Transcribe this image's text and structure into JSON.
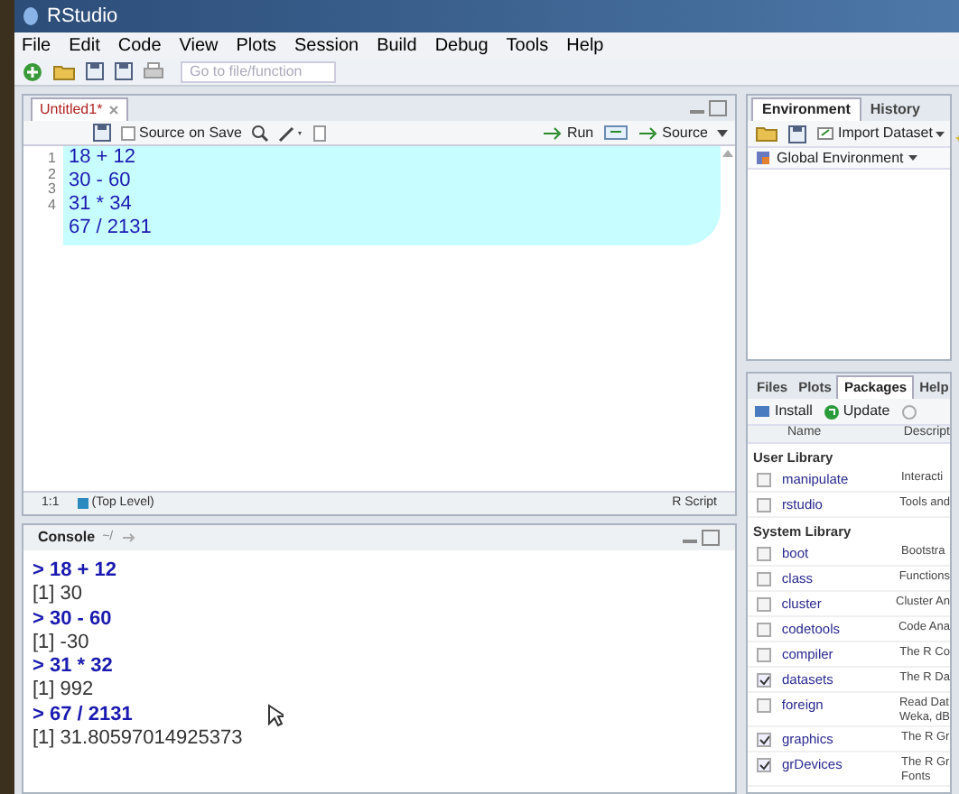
{
  "window": {
    "title": "RStudio"
  },
  "menu": [
    "File",
    "Edit",
    "Code",
    "View",
    "Plots",
    "Session",
    "Build",
    "Debug",
    "Tools",
    "Help"
  ],
  "toolbar": {
    "goto_placeholder": "Go to file/function"
  },
  "editor": {
    "tabs": [
      {
        "label": "Untitled1*",
        "selected": true
      }
    ],
    "source_on_save": {
      "label": "Source on Save",
      "checked": false
    },
    "run_label": "Run",
    "source_label": "Source",
    "line_numbers": [
      "1",
      "2",
      "3",
      "4"
    ],
    "code_lines": [
      "18 + 12",
      "30 - 60",
      "31 * 34",
      "67 / 2131"
    ],
    "status": {
      "position": "1:1",
      "scope": "(Top Level)",
      "file_type": "R Script"
    }
  },
  "console": {
    "title": "Console",
    "path": "~/",
    "lines": [
      {
        "kind": "input",
        "text": "> 18 + 12"
      },
      {
        "kind": "output",
        "text": "[1] 30"
      },
      {
        "kind": "input",
        "text": "> 30 - 60"
      },
      {
        "kind": "output",
        "text": "[1] -30"
      },
      {
        "kind": "input",
        "text": "> 31 * 32"
      },
      {
        "kind": "output",
        "text": "[1] 992"
      },
      {
        "kind": "input",
        "text": "> 67 / 2131"
      },
      {
        "kind": "output",
        "text": "[1] 31.80597014925373"
      }
    ]
  },
  "environment": {
    "tabs": [
      {
        "label": "Environment",
        "selected": true
      },
      {
        "label": "History",
        "selected": false
      }
    ],
    "import_label": "Import Dataset",
    "scope": "Global Environment"
  },
  "packages_pane": {
    "tabs": [
      {
        "label": "Files",
        "selected": false
      },
      {
        "label": "Plots",
        "selected": false
      },
      {
        "label": "Packages",
        "selected": true
      },
      {
        "label": "Help",
        "selected": false
      }
    ],
    "install_label": "Install",
    "update_label": "Update",
    "columns": [
      "Name",
      "Descript"
    ],
    "groups": [
      {
        "title": "User Library",
        "packages": [
          {
            "name": "manipulate",
            "description": "Interacti",
            "checked": false
          },
          {
            "name": "rstudio",
            "description": "Tools and",
            "checked": false
          }
        ]
      },
      {
        "title": "System Library",
        "packages": [
          {
            "name": "boot",
            "description": "Bootstra",
            "checked": false
          },
          {
            "name": "class",
            "description": "Functions",
            "checked": false
          },
          {
            "name": "cluster",
            "description": "Cluster An",
            "checked": false
          },
          {
            "name": "codetools",
            "description": "Code Ana",
            "checked": false
          },
          {
            "name": "compiler",
            "description": "The R Co",
            "checked": false
          },
          {
            "name": "datasets",
            "description": "The R Da",
            "checked": true
          },
          {
            "name": "foreign",
            "description": "Read Dat\nWeka, dB",
            "checked": false
          },
          {
            "name": "graphics",
            "description": "The R Gr",
            "checked": true
          },
          {
            "name": "grDevices",
            "description": "The R Gr\nFonts",
            "checked": true
          }
        ]
      }
    ]
  }
}
